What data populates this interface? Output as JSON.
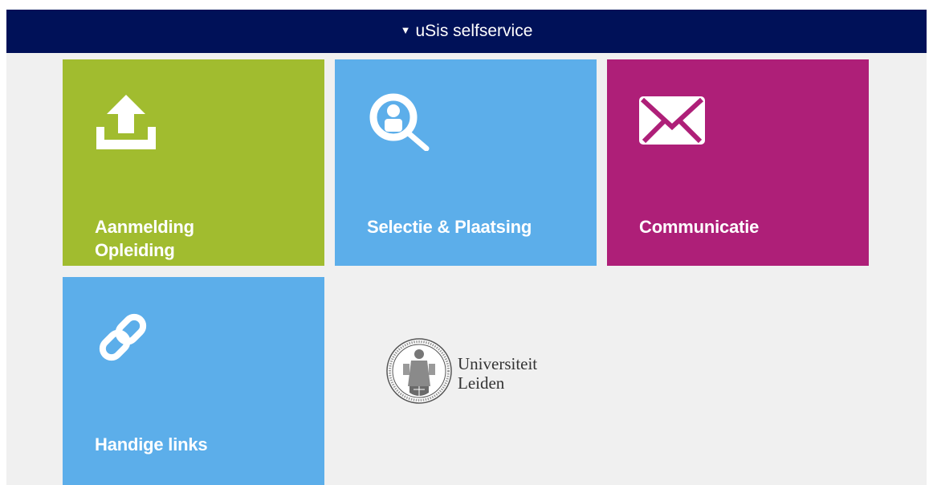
{
  "header": {
    "title": "uSis selfservice",
    "caret": "▼"
  },
  "tiles": [
    {
      "label_line1": "Aanmelding",
      "label_line2": "Opleiding",
      "icon": "upload-icon",
      "color": "#a1bc2f"
    },
    {
      "label": "Selectie & Plaatsing",
      "icon": "search-person-icon",
      "color": "#5caeea"
    },
    {
      "label": "Communicatie",
      "icon": "envelope-icon",
      "color": "#ae1f78"
    },
    {
      "label": "Handige links",
      "icon": "link-icon",
      "color": "#5caeea"
    }
  ],
  "logo": {
    "line1": "Universiteit",
    "line2": "Leiden"
  },
  "colors": {
    "header_bg": "#001158",
    "page_bg": "#f0f0f0"
  }
}
